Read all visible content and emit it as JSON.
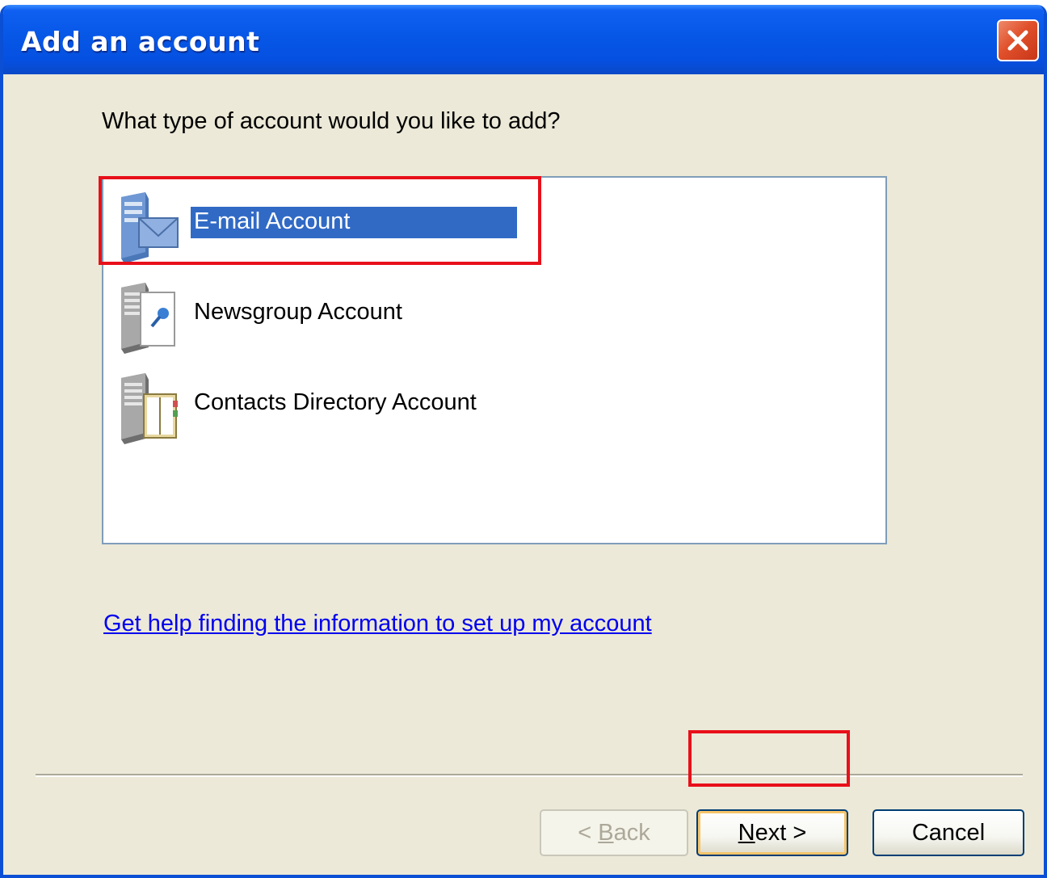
{
  "window": {
    "title": "Add an account"
  },
  "dialog": {
    "prompt": "What type of account would you like to add?",
    "account_types": [
      {
        "label": "E-mail Account",
        "icon": "email-server-icon",
        "selected": true
      },
      {
        "label": "Newsgroup Account",
        "icon": "newsgroup-server-icon",
        "selected": false
      },
      {
        "label": "Contacts Directory Account",
        "icon": "directory-server-icon",
        "selected": false
      }
    ],
    "help_link": "Get help finding the information to set up my account"
  },
  "buttons": {
    "back": {
      "prefix": "< ",
      "mnemonic": "B",
      "rest": "ack",
      "enabled": false
    },
    "next": {
      "mnemonic": "N",
      "rest": "ext >",
      "enabled": true
    },
    "cancel": "Cancel"
  },
  "colors": {
    "titlebar": "#0757e7",
    "selection": "#316ac5",
    "highlight_box": "#e8101a",
    "link": "#0000ee"
  }
}
